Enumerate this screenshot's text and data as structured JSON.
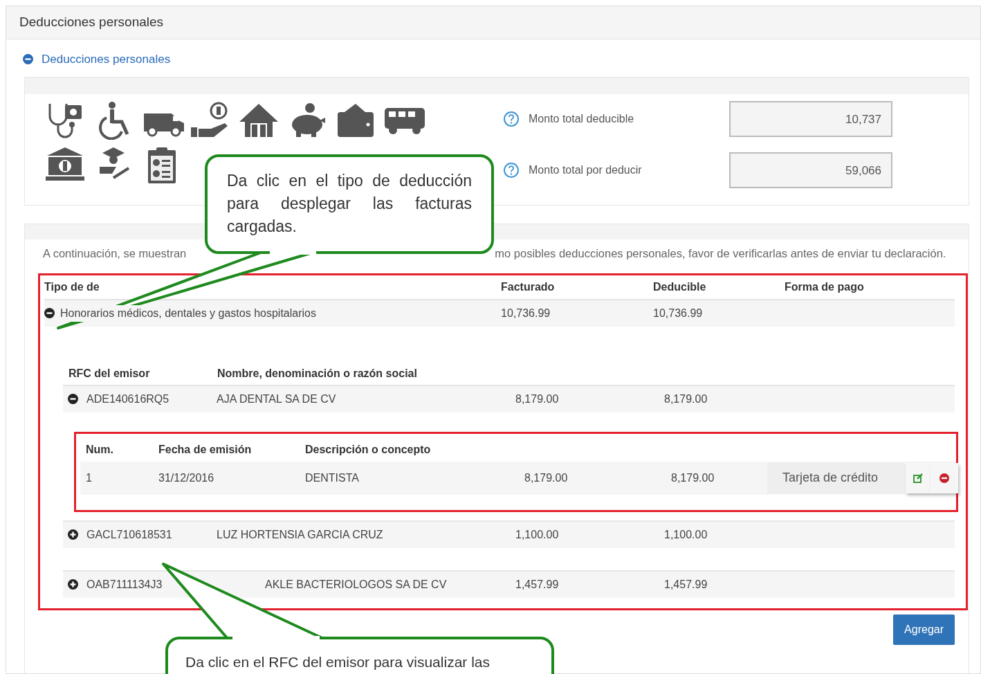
{
  "panel_title": "Deducciones personales",
  "section": {
    "label": "Deducciones personales",
    "expanded": true
  },
  "totals": [
    {
      "label": "Monto total deducible",
      "value": "10,737"
    },
    {
      "label": "Monto total por deducir",
      "value": "59,066"
    }
  ],
  "intro": [
    "A continuación, se muestran",
    "mo posibles deducciones personales, favor de verificarlas antes de enviar tu declaración."
  ],
  "table": {
    "columns": [
      "Tipo de de",
      "Facturado",
      "Deducible",
      "Forma de pago"
    ],
    "rows": [
      {
        "type": "Honorarios médicos, dentales y gastos hospitalarios",
        "billed": "10,736.99",
        "deductible": "10,736.99",
        "expanded": true,
        "issuer_columns": [
          "RFC del emisor",
          "Nombre, denominación o razón social"
        ],
        "issuers": [
          {
            "rfc": "ADE140616RQ5",
            "name": "AJA DENTAL SA DE CV",
            "billed": "8,179.00",
            "deductible": "8,179.00",
            "expanded": true,
            "invoice_columns": [
              "Num.",
              "Fecha de emisión",
              "Descripción o concepto"
            ],
            "invoices": [
              {
                "num": "1",
                "date": "31/12/2016",
                "concept": "DENTISTA",
                "billed": "8,179.00",
                "deductible": "8,179.00",
                "payment": "Tarjeta de crédito"
              }
            ]
          },
          {
            "rfc": "GACL710618531",
            "name": "LUZ HORTENSIA GARCIA CRUZ",
            "billed": "1,100.00",
            "deductible": "1,100.00",
            "expanded": false
          },
          {
            "rfc": "OAB7111134J3",
            "name": "AKLE BACTERIOLOGOS SA DE CV",
            "billed": "1,457.99",
            "deductible": "1,457.99",
            "expanded": false
          }
        ]
      }
    ]
  },
  "button": "Agregar",
  "callouts": [
    "Da clic en el tipo de deducción para desplegar las facturas cargadas.",
    "Da clic en el RFC del emisor para visualizar las"
  ]
}
